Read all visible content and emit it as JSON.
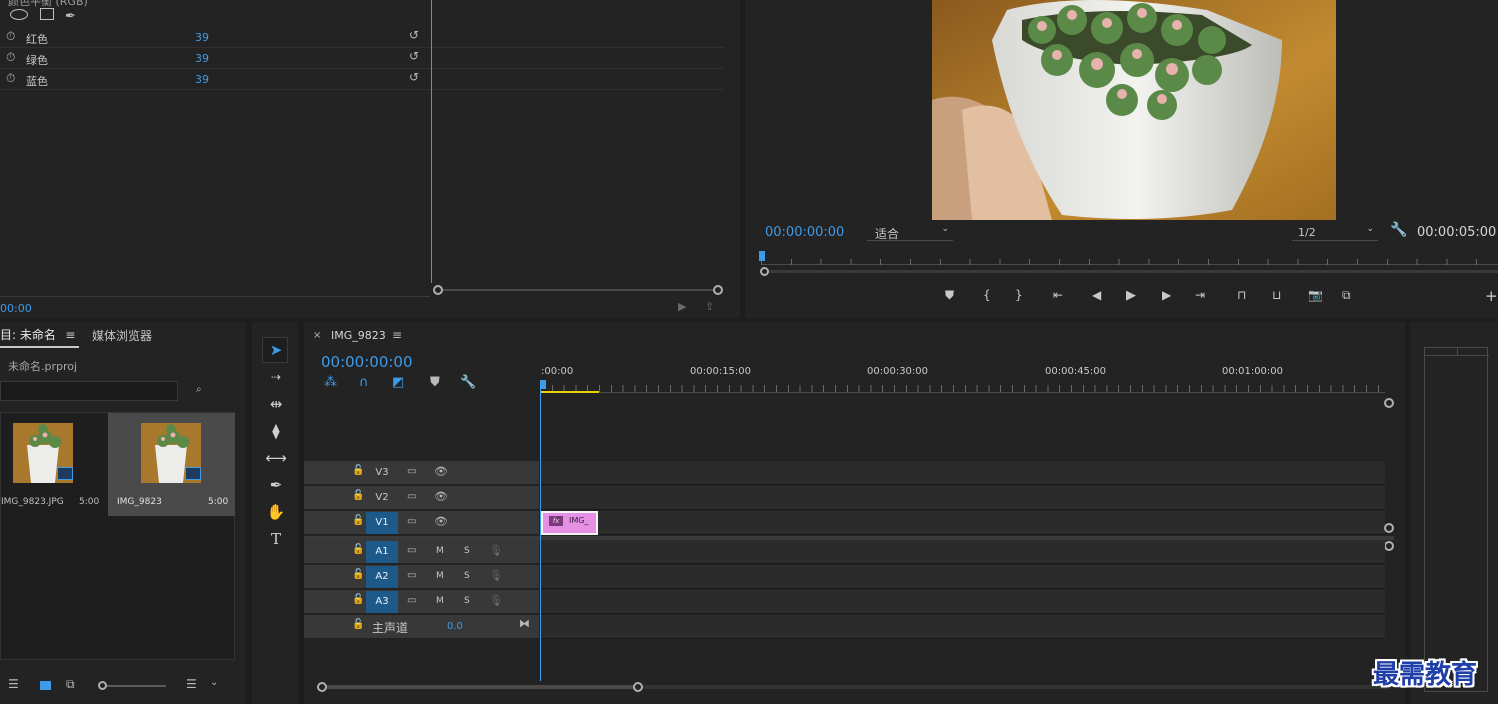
{
  "effects": {
    "partial_title": "颜色平衡 (RGB)",
    "params": [
      {
        "label": "红色",
        "value": "39"
      },
      {
        "label": "绿色",
        "value": "39"
      },
      {
        "label": "蓝色",
        "value": "39"
      }
    ],
    "timecode": "00:00"
  },
  "program": {
    "timecode": "00:00:00:00",
    "fit_label": "适合",
    "resolution": "1/2",
    "duration": "00:00:05:00"
  },
  "project": {
    "tab_label": "目: 未命名",
    "media_tab": "媒体浏览器",
    "file_name": "未命名.prproj",
    "items": [
      {
        "name": "IMG_9823.JPG",
        "duration": "5:00"
      },
      {
        "name": "IMG_9823",
        "duration": "5:00"
      }
    ]
  },
  "timeline": {
    "seq_name": "IMG_9823",
    "timecode": "00:00:00:00",
    "ruler": [
      ":00:00",
      "00:00:15:00",
      "00:00:30:00",
      "00:00:45:00",
      "00:01:00:00"
    ],
    "video_tracks": [
      "V3",
      "V2",
      "V1"
    ],
    "audio_tracks": [
      "A1",
      "A2",
      "A3"
    ],
    "mute": "M",
    "solo": "S",
    "master_label": "主声道",
    "master_value": "0.0",
    "clip_label": "IMG_",
    "clip_fx": "fx"
  },
  "watermark": "最需教育",
  "colors": {
    "accent": "#3d9be9",
    "clip": "#e58fe5",
    "work_area": "#e8d400"
  }
}
